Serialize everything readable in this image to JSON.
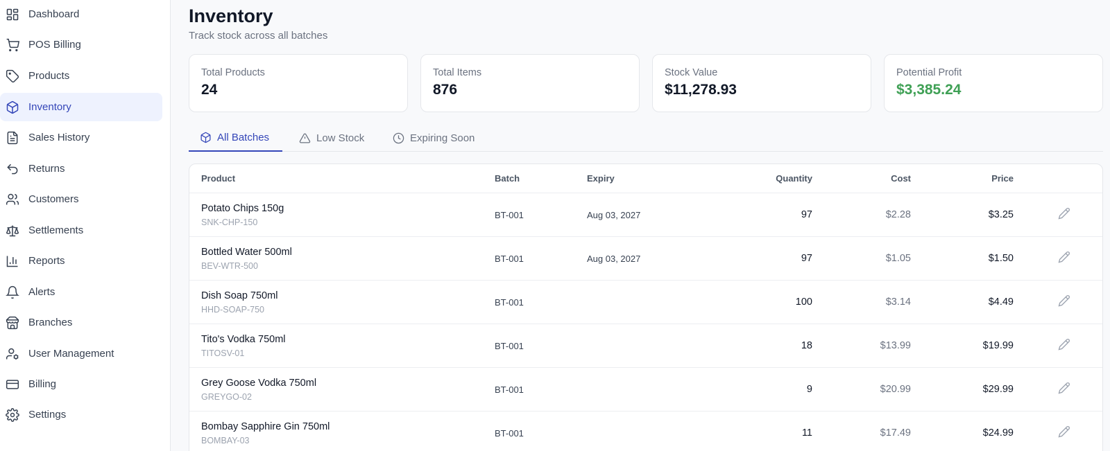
{
  "sidebar": {
    "items": [
      {
        "label": "Dashboard",
        "icon": "dashboard-icon"
      },
      {
        "label": "POS Billing",
        "icon": "cart-icon"
      },
      {
        "label": "Products",
        "icon": "tag-icon"
      },
      {
        "label": "Inventory",
        "icon": "box-icon"
      },
      {
        "label": "Sales History",
        "icon": "document-icon"
      },
      {
        "label": "Returns",
        "icon": "undo-icon"
      },
      {
        "label": "Customers",
        "icon": "users-icon"
      },
      {
        "label": "Settlements",
        "icon": "scale-icon"
      },
      {
        "label": "Reports",
        "icon": "bar-chart-icon"
      },
      {
        "label": "Alerts",
        "icon": "bell-icon"
      },
      {
        "label": "Branches",
        "icon": "store-icon"
      },
      {
        "label": "User Management",
        "icon": "user-cog-icon"
      },
      {
        "label": "Billing",
        "icon": "credit-card-icon"
      },
      {
        "label": "Settings",
        "icon": "gear-icon"
      }
    ],
    "active": "Inventory"
  },
  "header": {
    "title": "Inventory",
    "subtitle": "Track stock across all batches"
  },
  "stats": [
    {
      "label": "Total Products",
      "value": "24"
    },
    {
      "label": "Total Items",
      "value": "876"
    },
    {
      "label": "Stock Value",
      "value": "$11,278.93"
    },
    {
      "label": "Potential Profit",
      "value": "$3,385.24"
    }
  ],
  "tabs": [
    {
      "label": "All Batches",
      "icon": "box-icon"
    },
    {
      "label": "Low Stock",
      "icon": "warning-icon"
    },
    {
      "label": "Expiring Soon",
      "icon": "clock-icon"
    }
  ],
  "table": {
    "headers": {
      "product": "Product",
      "batch": "Batch",
      "expiry": "Expiry",
      "quantity": "Quantity",
      "cost": "Cost",
      "price": "Price"
    },
    "rows": [
      {
        "name": "Potato Chips 150g",
        "sku": "SNK-CHP-150",
        "batch": "BT-001",
        "expiry": "Aug 03, 2027",
        "quantity": "97",
        "cost": "$2.28",
        "price": "$3.25"
      },
      {
        "name": "Bottled Water 500ml",
        "sku": "BEV-WTR-500",
        "batch": "BT-001",
        "expiry": "Aug 03, 2027",
        "quantity": "97",
        "cost": "$1.05",
        "price": "$1.50"
      },
      {
        "name": "Dish Soap 750ml",
        "sku": "HHD-SOAP-750",
        "batch": "BT-001",
        "expiry": "",
        "quantity": "100",
        "cost": "$3.14",
        "price": "$4.49"
      },
      {
        "name": "Tito's Vodka 750ml",
        "sku": "TITOSV-01",
        "batch": "BT-001",
        "expiry": "",
        "quantity": "18",
        "cost": "$13.99",
        "price": "$19.99"
      },
      {
        "name": "Grey Goose Vodka 750ml",
        "sku": "GREYGO-02",
        "batch": "BT-001",
        "expiry": "",
        "quantity": "9",
        "cost": "$20.99",
        "price": "$29.99"
      },
      {
        "name": "Bombay Sapphire Gin 750ml",
        "sku": "BOMBAY-03",
        "batch": "BT-001",
        "expiry": "",
        "quantity": "11",
        "cost": "$17.49",
        "price": "$24.99"
      }
    ]
  },
  "colors": {
    "accent": "#3446b8",
    "active_bg": "#eef2fe",
    "profit_green": "#3fa055"
  }
}
